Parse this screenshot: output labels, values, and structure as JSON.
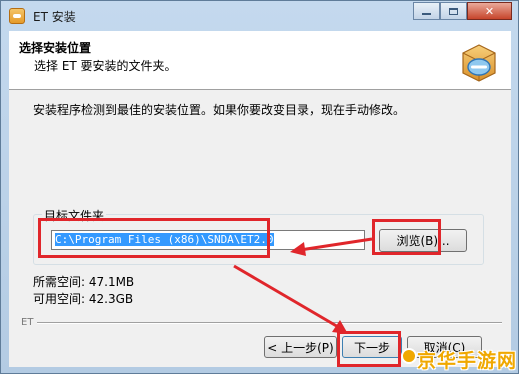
{
  "window": {
    "title": "ET 安装",
    "icon": "et-app-icon",
    "controls": {
      "minimize": "minimize-icon",
      "maximize": "maximize-icon",
      "close": "close-icon"
    }
  },
  "header": {
    "title": "选择安装位置",
    "subtitle": "选择 ET 要安装的文件夹。",
    "icon": "installer-box-icon"
  },
  "body": {
    "intro": "安装程序检测到最佳的安装位置。如果你要改变目录，现在手动修改。",
    "group_label": "目标文件夹",
    "path_value": "C:\\Program Files (x86)\\SNDA\\ET2.0",
    "browse_label": "浏览(B)...",
    "required_space": "所需空间: 47.1MB",
    "available_space": "可用空间: 42.3GB"
  },
  "footer": {
    "brand": "ET",
    "back_label": "< 上一步(P)",
    "next_label": "下一步",
    "cancel_label": "取消(C)"
  },
  "annotations": {
    "highlight_color": "#e0262b"
  },
  "watermark": {
    "text": "京华手游网"
  }
}
